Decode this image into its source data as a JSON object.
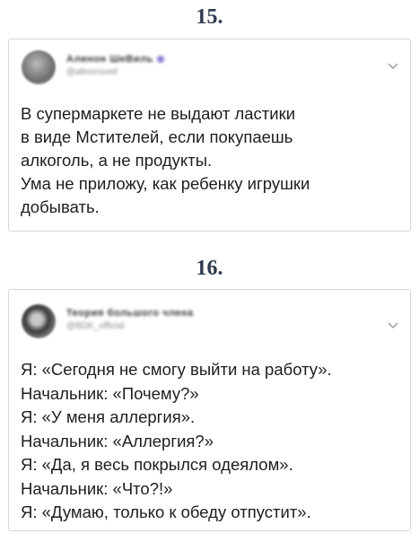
{
  "posts": [
    {
      "number": "15.",
      "author_name": "Алинон ШеВиль",
      "author_handle": "@alinonsveil",
      "text": "В супермаркете не выдают ластики\nв виде Мстителей, если покупаешь\nалкоголь, а не продукты.\nУма не приложу, как ребенку игрушки\nдобывать."
    },
    {
      "number": "16.",
      "author_name": "Теория большого члена",
      "author_handle": "@BDK_official",
      "text": "Я: «Сегодня не смогу выйти на работу».\nНачальник: «Почему?»\nЯ: «У меня аллергия».\nНачальник: «Аллергия?»\nЯ: «Да, я весь покрылся одеялом».\nНачальник: «Что?!»\nЯ: «Думаю, только к обеду отпустит»."
    }
  ],
  "icons": {
    "chevron": "chevron-down-icon",
    "verified": "verified-badge-icon"
  },
  "colors": {
    "number": "#2e3a4f",
    "border": "#d6d6d6",
    "badge": "#8a7fd1"
  }
}
